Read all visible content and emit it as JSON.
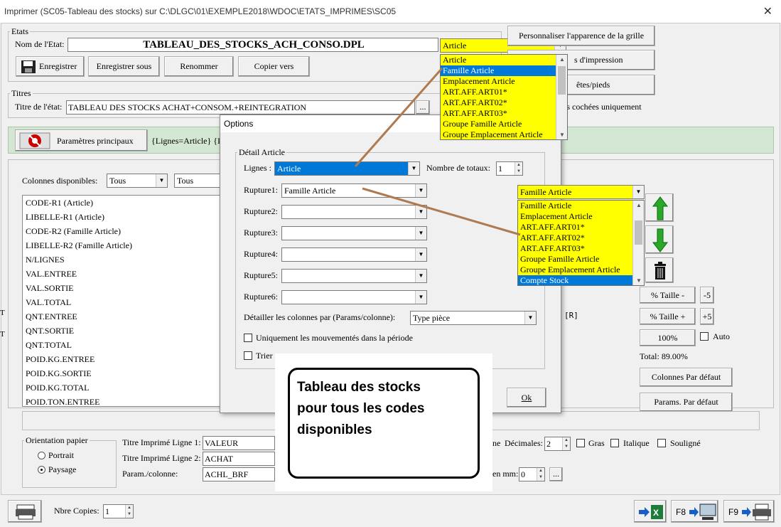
{
  "window": {
    "title": "Imprimer (SC05-Tableau des stocks)  sur C:\\DLGC\\01\\EXEMPLE2018\\WDOC\\ETATS_IMPRIMES\\SC05",
    "close_glyph": "✕"
  },
  "etats": {
    "group_label": "Etats",
    "nom_label": "Nom de l'Etat:",
    "nom_value": "TABLEAU_DES_STOCKS_ACH_CONSO.DPL",
    "type_combo": "Article",
    "buttons": {
      "enregistrer": "Enregistrer",
      "enregistrer_sous": "Enregistrer sous",
      "renommer": "Renommer",
      "copier_vers": "Copier vers"
    }
  },
  "right_buttons": {
    "apparence": "Personnaliser l'apparence de la grille",
    "impression": "s d'impression",
    "entetes": "êtes/pieds",
    "cochees": "nes cochées uniquement"
  },
  "type_dropdown": {
    "items": [
      "Article",
      "Famille Article",
      "Emplacement Article",
      "ART.AFF.ART01*",
      "ART.AFF.ART02*",
      "ART.AFF.ART03*",
      "Groupe Famille Article",
      "Groupe Emplacement Article"
    ],
    "selected_index": 1
  },
  "titres": {
    "group_label": "Titres",
    "titre_label": "Titre de l'état:",
    "titre_value": "TABLEAU DES STOCKS ACHAT+CONSOM.+REINTEGRATION",
    "ellipsis": "..."
  },
  "params": {
    "button": "Paramètres principaux",
    "summary": "{Lignes=Article} {I"
  },
  "colonnes": {
    "label": "Colonnes disponibles:",
    "filter1": "Tous",
    "filter2": "Tous",
    "items": [
      "CODE-R1 (Article)",
      "LIBELLE-R1 (Article)",
      "CODE-R2 (Famille Article)",
      "LIBELLE-R2 (Famille Article)",
      "N/LIGNES",
      "VAL.ENTREE",
      "VAL.SORTIE",
      "VAL.TOTAL",
      "QNT.ENTREE",
      "QNT.SORTIE",
      "QNT.TOTAL",
      "POID.KG.ENTREE",
      "POID.KG.SORTIE",
      "POID.KG.TOTAL",
      "POID.TON.ENTREE"
    ]
  },
  "options_dialog": {
    "title": "Options",
    "group_label": "Détail Article",
    "lignes_label": "Lignes :",
    "lignes_value": "Article",
    "totaux_label": "Nombre de totaux:",
    "totaux_value": "1",
    "ruptures": [
      {
        "label": "Rupture1:",
        "value": "Famille Article"
      },
      {
        "label": "Rupture2:",
        "value": ""
      },
      {
        "label": "Rupture3:",
        "value": ""
      },
      {
        "label": "Rupture4:",
        "value": ""
      },
      {
        "label": "Rupture5:",
        "value": ""
      },
      {
        "label": "Rupture6:",
        "value": ""
      }
    ],
    "detailler_label": "Détailler les colonnes par (Params/colonne):",
    "detailler_value": "Type pièce",
    "check1": "Uniquement les mouvementés dans la période",
    "check2": "Trier",
    "ok": "Ok"
  },
  "rupture_dropdown": {
    "combo_value": "Famille Article",
    "items": [
      "Famille Article",
      "Emplacement Article",
      "ART.AFF.ART01*",
      "ART.AFF.ART02*",
      "ART.AFF.ART03*",
      "Groupe Famille Article",
      "Groupe Emplacement Article",
      "Compte Stock"
    ],
    "selected_index": 7
  },
  "right_panel": {
    "taille_minus": "% Taille -",
    "minus5": "-5",
    "taille_plus": "% Taille +",
    "plus5": "+5",
    "hundred": "100%",
    "auto": "Auto",
    "total": "Total:  89.00%",
    "colonnes_defaut": "Colonnes Par défaut",
    "params_defaut": "Params. Par défaut",
    "r_marker": "[R]"
  },
  "orientation": {
    "label": "Orientation papier",
    "portrait": "Portrait",
    "paysage": "Paysage"
  },
  "bottom": {
    "ligne1_label": "Titre Imprimé Ligne 1:",
    "ligne1_value": "VALEUR",
    "ligne2_label": "Titre Imprimé Ligne 2:",
    "ligne2_value": "ACHAT",
    "param_label": "Param./colonne:",
    "param_value": "ACHL_BRF",
    "ne_fragment": "ne",
    "decimales_label": "Décimales:",
    "decimales_value": "2",
    "gras": "Gras",
    "italique": "Italique",
    "souligne": "Souligné",
    "mm_label": "en mm:",
    "mm_value": "0",
    "ellipsis": "..."
  },
  "footer": {
    "copies_label": "Nbre Copies:",
    "copies_value": "1",
    "f8": "F8",
    "f9": "F9"
  },
  "callout": {
    "text_lines": [
      "Tableau des stocks",
      "pour tous les codes",
      "disponibles"
    ]
  },
  "colors": {
    "highlight": "#ffff00",
    "selection": "#0078d7",
    "params_bar": "#d4e7d4",
    "arrow_up": "#2aa82a",
    "arrow_down": "#2aa82a",
    "connector": "#b07a50"
  }
}
